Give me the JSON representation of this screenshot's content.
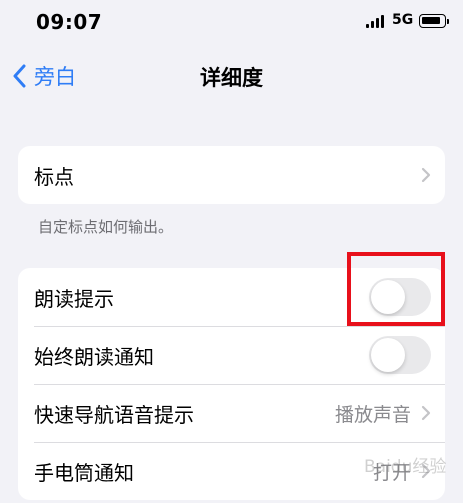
{
  "status_bar": {
    "time": "09:07",
    "network": "5G"
  },
  "nav": {
    "back_label": "旁白",
    "title": "详细度"
  },
  "punctuation_group": {
    "label": "标点",
    "footnote": "自定标点如何输出。"
  },
  "settings_group": {
    "rows": [
      {
        "label": "朗读提示",
        "control": "toggle",
        "enabled": false
      },
      {
        "label": "始终朗读通知",
        "control": "toggle",
        "enabled": false
      },
      {
        "label": "快速导航语音提示",
        "control": "disclosure",
        "value": "播放声音"
      },
      {
        "label": "手电筒通知",
        "control": "disclosure",
        "value": "打开"
      }
    ]
  },
  "colors": {
    "accent": "#2f7df6",
    "background": "#f2f2f7",
    "highlight": "#e8101b",
    "toggle_off": "#e9e9eb"
  },
  "watermark": "Baidu经验"
}
